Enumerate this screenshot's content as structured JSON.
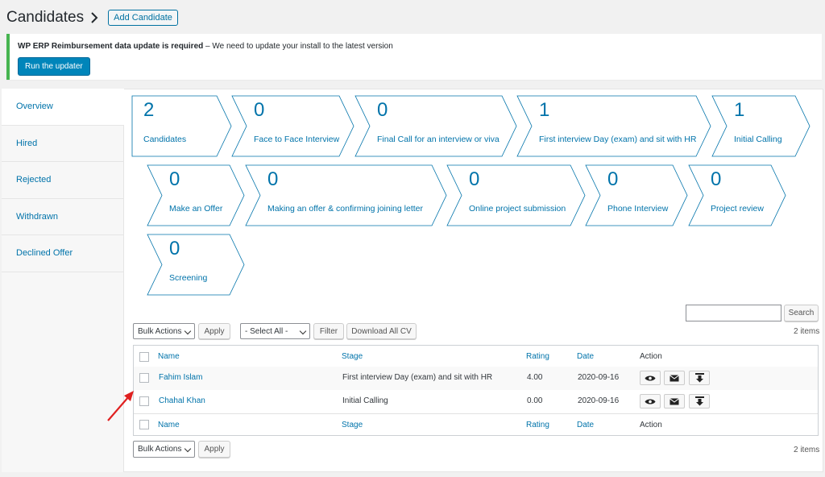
{
  "header": {
    "title": "Candidates",
    "add_button": "Add Candidate"
  },
  "notice": {
    "bold": "WP ERP Reimbursement data update is required",
    "text": " – We need to update your install to the latest version",
    "button": "Run the updater"
  },
  "sidebar": {
    "items": [
      {
        "label": "Overview"
      },
      {
        "label": "Hired"
      },
      {
        "label": "Rejected"
      },
      {
        "label": "Withdrawn"
      },
      {
        "label": "Declined Offer"
      }
    ]
  },
  "stages": [
    {
      "count": "2",
      "label": "Candidates"
    },
    {
      "count": "0",
      "label": "Face to Face Interview"
    },
    {
      "count": "0",
      "label": "Final Call for an interview or viva"
    },
    {
      "count": "1",
      "label": "First interview Day (exam) and sit with HR"
    },
    {
      "count": "1",
      "label": "Initial Calling"
    },
    {
      "count": "0",
      "label": "Make an Offer"
    },
    {
      "count": "0",
      "label": "Making an offer & confirming joining letter"
    },
    {
      "count": "0",
      "label": "Online project submission"
    },
    {
      "count": "0",
      "label": "Phone Interview"
    },
    {
      "count": "0",
      "label": "Project review"
    },
    {
      "count": "0",
      "label": "Screening"
    }
  ],
  "toolbar": {
    "search_button": "Search",
    "bulk_actions": "Bulk Actions",
    "apply": "Apply",
    "select_all": "- Select All -",
    "filter": "Filter",
    "download": "Download All CV",
    "count": "2 items"
  },
  "table": {
    "columns": {
      "name": "Name",
      "stage": "Stage",
      "rating": "Rating",
      "date": "Date",
      "action": "Action"
    },
    "rows": [
      {
        "name": "Fahim Islam",
        "stage": "First interview Day (exam) and sit with HR",
        "rating": "4.00",
        "date": "2020-09-16"
      },
      {
        "name": "Chahal Khan",
        "stage": "Initial Calling",
        "rating": "0.00",
        "date": "2020-09-16"
      }
    ]
  },
  "colors": {
    "accent": "#0073aa",
    "primary_button": "#0085ba",
    "notice_border": "#46b450",
    "arrow": "#e02020"
  }
}
